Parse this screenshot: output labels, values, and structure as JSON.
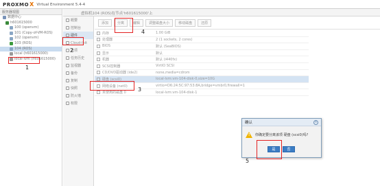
{
  "app": {
    "logo_text": "PROXMO",
    "logo_x": "X",
    "logo_sub": "Virtual Environment 5.4-4"
  },
  "tree": {
    "view_label": "服务器视图",
    "items": [
      {
        "label": "数据中心",
        "icon": "datacenter-icon",
        "indent": 4
      },
      {
        "label": "h601615000",
        "icon": "node-icon",
        "indent": 8
      },
      {
        "label": "100 (openvm)",
        "icon": "vm-icon",
        "indent": 14
      },
      {
        "label": "101 (Copy-of-VM-ROS)",
        "icon": "vm-icon",
        "indent": 14
      },
      {
        "label": "102 (openvm)",
        "icon": "vm-icon",
        "indent": 14
      },
      {
        "label": "103 (ROS)",
        "icon": "vm-running-icon",
        "indent": 14
      },
      {
        "label": "104 (ROS)",
        "icon": "vm-icon",
        "indent": 14
      },
      {
        "label": "local (h601615000)",
        "icon": "storage-icon",
        "indent": 14
      },
      {
        "label": "local-lvm (h601615000)",
        "icon": "storage-icon",
        "indent": 14
      }
    ]
  },
  "vm_header": {
    "title": "虚拟机104 (ROS)在节点'h601615000'上"
  },
  "vm_menu": [
    {
      "label": "概要",
      "icon": "summary-icon"
    },
    {
      "label": "控制台",
      "icon": "console-icon"
    },
    {
      "label": "硬件",
      "icon": "hardware-icon"
    },
    {
      "label": "Cloud-Init",
      "icon": "cloud-icon"
    },
    {
      "label": "选项",
      "icon": "options-icon"
    },
    {
      "label": "任务历史",
      "icon": "history-icon"
    },
    {
      "label": "监视器",
      "icon": "monitor-icon"
    },
    {
      "label": "备份",
      "icon": "backup-icon"
    },
    {
      "label": "复制",
      "icon": "replication-icon"
    },
    {
      "label": "快照",
      "icon": "snapshot-icon"
    },
    {
      "label": "防火墙",
      "icon": "firewall-icon"
    },
    {
      "label": "权限",
      "icon": "permissions-icon"
    }
  ],
  "toolbar": [
    {
      "label": "添加"
    },
    {
      "label": "分离"
    },
    {
      "label": "编辑"
    },
    {
      "label": "调整磁盘大小"
    },
    {
      "label": "移动磁盘"
    },
    {
      "label": "还原"
    }
  ],
  "hardware": [
    {
      "label": "内存",
      "value": "1.00 GiB"
    },
    {
      "label": "处理器",
      "value": "2 (1 sockets, 2 cores)"
    },
    {
      "label": "BIOS",
      "value": "默认 (SeaBIOS)"
    },
    {
      "label": "显示",
      "value": "默认"
    },
    {
      "label": "机器",
      "value": "默认 (i440fx)"
    },
    {
      "label": "SCSI控制器",
      "value": "VirtIO SCSI"
    },
    {
      "label": "CD/DVD驱动器 (ide2)",
      "value": "none,media=cdrom"
    },
    {
      "label": "硬盘 (scsi0)",
      "value": "local-lvm:vm-104-disk-0,size=10G"
    },
    {
      "label": "网络设备 (net0)",
      "value": "virtio=D6:24:5C:97:53:8A,bridge=vmbr0,firewall=1"
    },
    {
      "label": "未使用的磁盘 0",
      "value": "local-lvm:vm-104-disk-1"
    }
  ],
  "dialog": {
    "title": "确认",
    "message": "你确定要分离该项 硬盘 (scsi0)吗?",
    "yes": "是",
    "no": "否"
  },
  "annotations": [
    "1",
    "2",
    "3",
    "4",
    "5"
  ],
  "colors": {
    "annotation": "#e32020",
    "selection": "#c9dcf0",
    "button_primary": "#3c7dc4",
    "logo_accent": "#e57000"
  }
}
